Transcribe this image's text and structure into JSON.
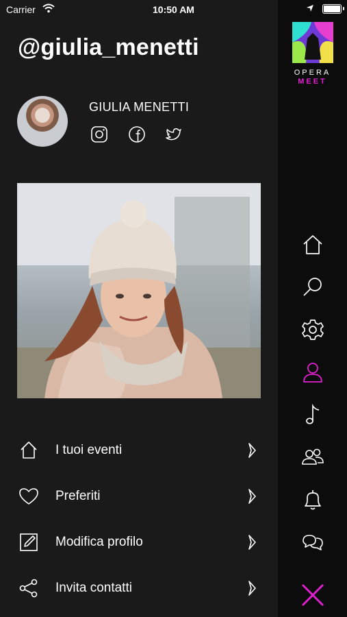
{
  "status": {
    "carrier": "Carrier",
    "time": "10:50 AM"
  },
  "profile": {
    "handle": "@giulia_menetti",
    "name": "GIULIA MENETTI"
  },
  "menu": [
    {
      "label": "I tuoi eventi",
      "icon": "home-icon"
    },
    {
      "label": "Preferiti",
      "icon": "heart-icon"
    },
    {
      "label": "Modifica profilo",
      "icon": "edit-icon"
    },
    {
      "label": "Invita contatti",
      "icon": "share-icon"
    }
  ],
  "brand": {
    "line1": "OPERA",
    "line2": "MEET",
    "accent": "#e020d0"
  },
  "sidebar": {
    "icons": [
      "home-icon",
      "search-icon",
      "settings-icon",
      "user-icon",
      "music-note-icon",
      "group-icon",
      "bell-icon",
      "chat-icon",
      "close-icon"
    ],
    "active": "user-icon"
  },
  "social_icons": [
    "instagram-icon",
    "facebook-icon",
    "twitter-icon"
  ]
}
